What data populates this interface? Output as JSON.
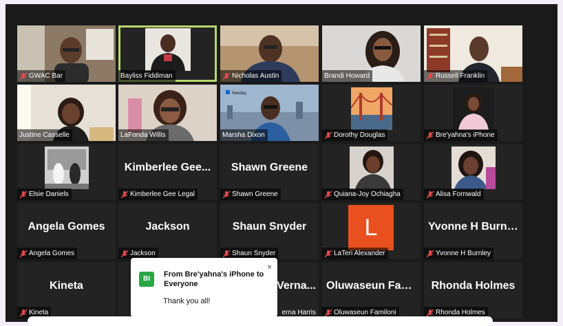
{
  "participants": [
    {
      "name": "GWAC Bar",
      "muted": true
    },
    {
      "name": "Bayliss Fiddiman",
      "muted": false,
      "active_speaker": true
    },
    {
      "name": "Nicholas Austin",
      "muted": true
    },
    {
      "name": "Brandi Howard",
      "muted": false
    },
    {
      "name": "Russell Franklin",
      "muted": true
    },
    {
      "name": "Justine Casselle",
      "muted": false
    },
    {
      "name": "LaFonda Willis",
      "muted": false
    },
    {
      "name": "Marsha Dixon",
      "muted": false
    },
    {
      "name": "Dorothy Douglas",
      "muted": true
    },
    {
      "name": "Bre'yahna's iPhone",
      "muted": true
    },
    {
      "name": "Elsie Daniels",
      "muted": true
    },
    {
      "name": "Kimberlee Gee Legal",
      "display": "Kimberlee  Gee...",
      "muted": true
    },
    {
      "name": "Shawn Greene",
      "display": "Shawn Greene",
      "muted": true
    },
    {
      "name": "Quiana-Joy Ochiagha",
      "muted": true
    },
    {
      "name": "Alisa Fornwald",
      "muted": true
    },
    {
      "name": "Angela Gomes",
      "display": "Angela Gomes",
      "muted": true
    },
    {
      "name": "Jackson",
      "display": "Jackson",
      "muted": true
    },
    {
      "name": "Shaun Snyder",
      "display": "Shaun Snyder",
      "muted": true
    },
    {
      "name": "LaTeri Alexander",
      "avatar_letter": "L",
      "muted": true
    },
    {
      "name": "Yvonne H Burnley",
      "display": "Yvonne  H  Burnl...",
      "muted": true
    },
    {
      "name": "Kineta",
      "display": "Kineta",
      "muted": true
    },
    {
      "name": "erna Harris",
      "display": "Verna...",
      "muted": false
    },
    {
      "name": "Oluwaseun Familoni",
      "display": "Oluwaseun  Fam...",
      "muted": true
    },
    {
      "name": "Rhonda Holmes",
      "display": "Rhonda Holmes",
      "muted": true
    }
  ],
  "chat": {
    "avatar_initials": "BI",
    "title": "From Bre'yahna's iPhone to Everyone",
    "message": "Thank you all!",
    "close_icon": "×"
  },
  "colors": {
    "muted_icon": "#e24b4b",
    "active_border": "#b7d96b",
    "avatar_L": "#e8501f",
    "chat_avatar": "#29a745"
  }
}
